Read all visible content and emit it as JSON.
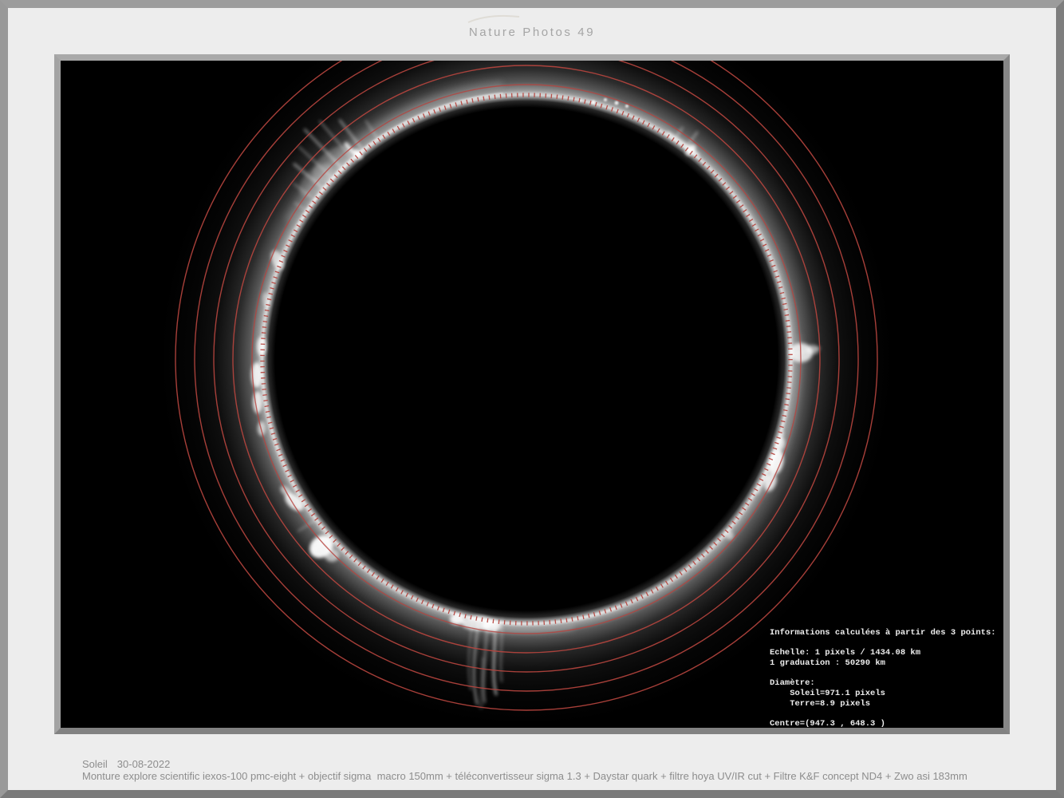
{
  "header": {
    "title": "Nature Photos 49"
  },
  "overlay": {
    "info_lines": [
      "Informations calculées à partir des 3 points:",
      "",
      "Echelle: 1 pixels / 1434.08 km",
      "1 graduation : 50290 km",
      "",
      "Diamètre:",
      "    Soleil=971.1 pixels",
      "    Terre=8.9 pixels",
      "",
      "Centre=(947.3 , 648.3 )"
    ]
  },
  "caption": {
    "subject": "Soleil",
    "date": "30-08-2022",
    "equipment": "Monture explore scientific iexos-100 pmc-eight + objectif sigma  macro 150mm + téléconvertisseur sigma 1.3 + Daystar quark + filtre hoya UV/IR cut + Filtre K&F concept ND4 + Zwo asi 183mm"
  },
  "colors": {
    "matte": "#ededed",
    "photo_background": "#000000",
    "graduation_red": "#b5443e",
    "limb_white": "#ececec",
    "info_text": "#ededed",
    "title_text": "#a5a5a5",
    "caption_text": "#8d8d8d"
  }
}
